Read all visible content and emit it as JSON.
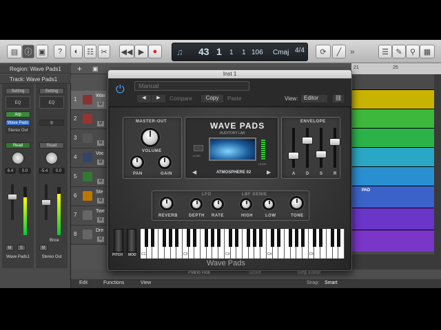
{
  "toolbar": {
    "lcd": {
      "bar": "43",
      "beat": "1",
      "div": "1",
      "tick": "1",
      "tempo": "106",
      "key": "Cmaj",
      "sig": "4/4"
    }
  },
  "inspector": {
    "region": "Region: Wave Pads1",
    "track": "Track: Wave Pads1",
    "strip1": {
      "setting": "Setting",
      "eq": "EQ",
      "arp": "Arp",
      "instrument": "Wave Pads",
      "output": "Stereo Out",
      "read": "Read",
      "pan": "6.4",
      "vol": "0.0",
      "name": "Wave Pads1",
      "m": "M",
      "s": "S"
    },
    "strip2": {
      "setting": "Setting",
      "eq": "EQ",
      "read": "Read",
      "vol": "-5.4",
      "vol2": "0.0",
      "bnce": "Bnce",
      "name": "Stereo Out",
      "m": "M"
    }
  },
  "tracks": [
    {
      "num": "1",
      "name": "Wav"
    },
    {
      "num": "2",
      "name": ""
    },
    {
      "num": "3",
      "name": ""
    },
    {
      "num": "4",
      "name": "Voc"
    },
    {
      "num": "5",
      "name": ""
    },
    {
      "num": "6",
      "name": "Ste"
    },
    {
      "num": "7",
      "name": "Twe"
    },
    {
      "num": "8",
      "name": "Dre"
    }
  ],
  "ruler": {
    "mark1": "21",
    "mark2": "25"
  },
  "region_label": "PAD",
  "plugin": {
    "window_title": "Inst 1",
    "preset": "Manual",
    "compare": "Compare",
    "copy": "Copy",
    "paste": "Paste",
    "view_label": "View:",
    "view_value": "Editor",
    "footer": "Wave Pads",
    "master_out": "MASTER-OUT",
    "volume": "VOLUME",
    "pan": "PAN",
    "gain": "GAIN",
    "brand_title": "WAVE PADS",
    "brand_sub": "AUDITORY LAB",
    "patch": "ATMOSPHERE 02",
    "load": "LOAD",
    "levels": "LEVEL",
    "envelope": "ENVELOPE",
    "env_labels": [
      "A",
      "D",
      "S",
      "R"
    ],
    "reverb": "REVERB",
    "lfo": "LFO",
    "depth": "DEPTH",
    "rate": "RATE",
    "eq": "EQ",
    "lbf_label": "LBF GENIE",
    "high": "HIGH",
    "low": "LOW",
    "tone": "TONE",
    "pitch": "PITCH",
    "mod": "MOD",
    "key_labels": [
      "C1",
      "C2",
      "C3",
      "C4",
      "C5"
    ]
  },
  "editor": {
    "tabs": [
      "Piano Roll",
      "Score",
      "Step Editor"
    ],
    "menu": [
      "Edit",
      "Functions",
      "View"
    ],
    "snap_label": "Snap:",
    "snap_value": "Smart"
  },
  "colors": {
    "accent": "#4aa3ff",
    "region_yellow": "#c8b400",
    "region_green": "#3db83d",
    "region_teal": "#2aa7c4",
    "region_blue": "#3a78d8",
    "region_purple": "#7a35c9"
  }
}
